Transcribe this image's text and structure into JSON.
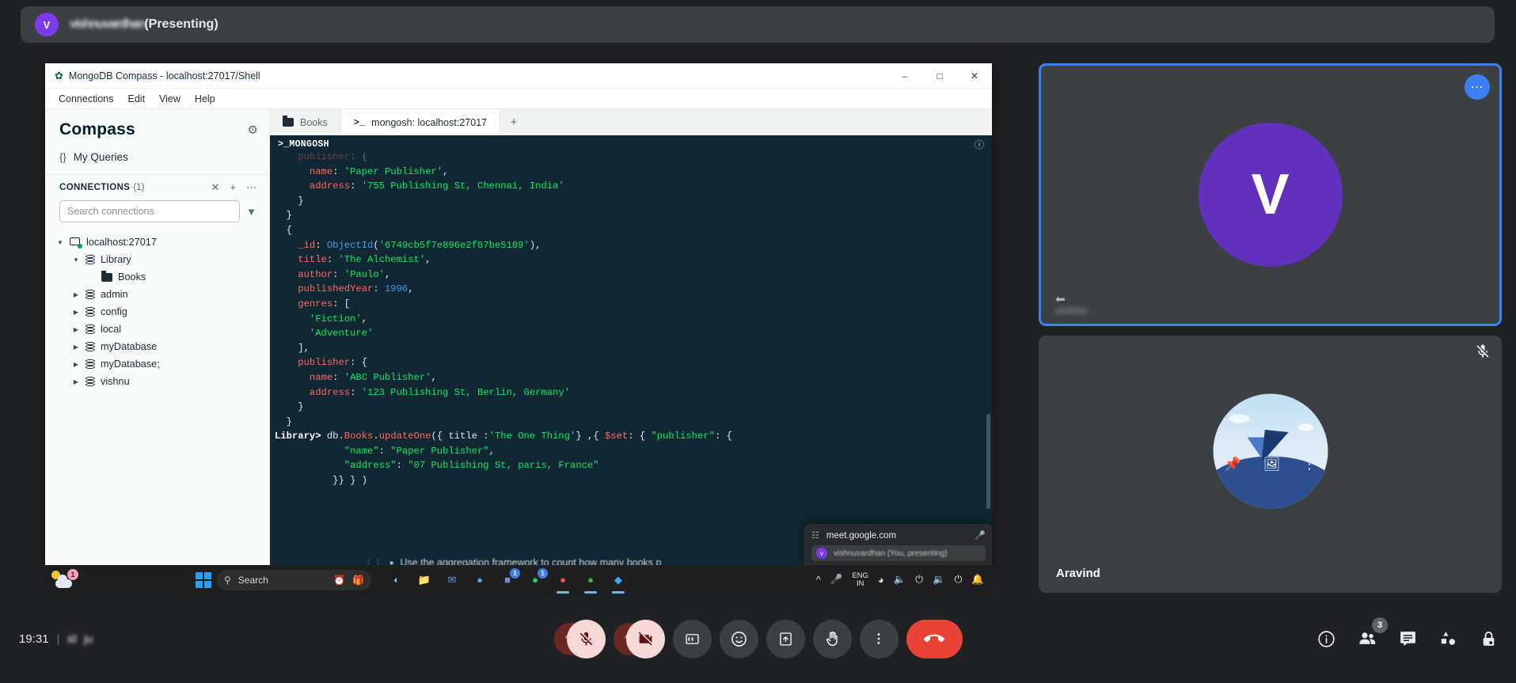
{
  "meet": {
    "topbar": {
      "avatar_initial": "V",
      "obscured_title": "vishnuvardhan",
      "title_suffix": "(Presenting)"
    },
    "tiles": [
      {
        "name": "presenter-tile",
        "avatar_initial": "V",
        "more_icon": "more-horizontal-icon",
        "blurred_name": "vishnu"
      },
      {
        "name": "participant-tile",
        "label": "Aravind",
        "mic_icon": "mic-off-icon",
        "hover_icons": [
          "pin-icon",
          "picture-in-picture-icon",
          "more-vertical-icon"
        ]
      }
    ],
    "bottom": {
      "time": "19:31",
      "separator": "|",
      "meeting_code_left": "id",
      "meeting_code_right": "ju",
      "controls": [
        {
          "name": "mic-options-chevron",
          "icon": "chevron-up-icon",
          "label": ""
        },
        {
          "name": "mic-toggle",
          "icon": "mic-off-icon",
          "label": ""
        },
        {
          "name": "camera-options-chevron",
          "icon": "chevron-up-icon",
          "label": ""
        },
        {
          "name": "camera-toggle",
          "icon": "video-off-icon",
          "label": ""
        },
        {
          "name": "captions-toggle",
          "icon": "closed-captions-icon",
          "label": ""
        },
        {
          "name": "reactions-button",
          "icon": "emoji-icon",
          "label": ""
        },
        {
          "name": "present-now-button",
          "icon": "present-screen-icon",
          "label": ""
        },
        {
          "name": "raise-hand-button",
          "icon": "raise-hand-icon",
          "label": ""
        },
        {
          "name": "more-options-button",
          "icon": "more-vertical-icon",
          "label": ""
        },
        {
          "name": "leave-call-button",
          "icon": "end-call-icon",
          "label": ""
        }
      ],
      "right_controls": [
        {
          "name": "meeting-details-button",
          "icon": "info-icon",
          "badge": ""
        },
        {
          "name": "participants-button",
          "icon": "people-icon",
          "badge": "3"
        },
        {
          "name": "chat-button",
          "icon": "chat-icon",
          "badge": ""
        },
        {
          "name": "activities-button",
          "icon": "activities-icon",
          "badge": ""
        },
        {
          "name": "host-controls-button",
          "icon": "lock-icon",
          "badge": ""
        }
      ]
    }
  },
  "compass": {
    "window_title": "MongoDB Compass - localhost:27017/Shell",
    "window_buttons": {
      "minimize": "–",
      "maximize": "□",
      "close": "✕"
    },
    "menus": [
      "Connections",
      "Edit",
      "View",
      "Help"
    ],
    "brand": "Compass",
    "gear_icon": "gear-icon",
    "my_queries": "My Queries",
    "connections_header": {
      "label": "CONNECTIONS",
      "count": "(1)",
      "actions": [
        "collapse-icon",
        "add-icon",
        "more-icon"
      ]
    },
    "search_placeholder": "Search connections",
    "filter_icon": "filter-icon",
    "tree": [
      {
        "label": "localhost:27017",
        "type": "host",
        "depth": 0,
        "caret": "open"
      },
      {
        "label": "Library",
        "type": "db",
        "depth": 1,
        "caret": "open"
      },
      {
        "label": "Books",
        "type": "collection",
        "depth": 2,
        "caret": "none"
      },
      {
        "label": "admin",
        "type": "db",
        "depth": 1,
        "caret": "closed"
      },
      {
        "label": "config",
        "type": "db",
        "depth": 1,
        "caret": "closed"
      },
      {
        "label": "local",
        "type": "db",
        "depth": 1,
        "caret": "closed"
      },
      {
        "label": "myDatabase",
        "type": "db",
        "depth": 1,
        "caret": "closed"
      },
      {
        "label": "myDatabase;",
        "type": "db",
        "depth": 1,
        "caret": "closed"
      },
      {
        "label": "vishnu",
        "type": "db",
        "depth": 1,
        "caret": "closed"
      }
    ],
    "tabs": [
      {
        "label": "Books",
        "icon": "folder-icon",
        "active": false
      },
      {
        "label": "mongosh: localhost:27017",
        "icon": "shell-icon",
        "active": true
      }
    ],
    "tab_add": "+",
    "shell": {
      "header_label": ">_MONGOSH",
      "info_icon": "info-icon",
      "lines": [
        {
          "indent": 4,
          "segments": [
            {
              "t": "publisher",
              "c": "key"
            },
            {
              "t": ": {",
              "c": "plain"
            }
          ],
          "faded": true
        },
        {
          "indent": 6,
          "segments": [
            {
              "t": "name",
              "c": "key"
            },
            {
              "t": ": ",
              "c": "plain"
            },
            {
              "t": "'Paper Publisher'",
              "c": "str"
            },
            {
              "t": ",",
              "c": "plain"
            }
          ]
        },
        {
          "indent": 6,
          "segments": [
            {
              "t": "address",
              "c": "key"
            },
            {
              "t": ": ",
              "c": "plain"
            },
            {
              "t": "'755 Publishing St, Chennai, India'",
              "c": "str"
            }
          ]
        },
        {
          "indent": 4,
          "segments": [
            {
              "t": "}",
              "c": "plain"
            }
          ]
        },
        {
          "indent": 2,
          "segments": [
            {
              "t": "}",
              "c": "plain"
            }
          ]
        },
        {
          "indent": 2,
          "segments": [
            {
              "t": "{",
              "c": "plain"
            }
          ]
        },
        {
          "indent": 4,
          "segments": [
            {
              "t": "_id",
              "c": "key"
            },
            {
              "t": ": ",
              "c": "plain"
            },
            {
              "t": "ObjectId",
              "c": "oid"
            },
            {
              "t": "(",
              "c": "plain"
            },
            {
              "t": "'6749cb5f7e896e2f87be5109'",
              "c": "str"
            },
            {
              "t": "),",
              "c": "plain"
            }
          ]
        },
        {
          "indent": 4,
          "segments": [
            {
              "t": "title",
              "c": "key"
            },
            {
              "t": ": ",
              "c": "plain"
            },
            {
              "t": "'The Alchemist'",
              "c": "str"
            },
            {
              "t": ",",
              "c": "plain"
            }
          ]
        },
        {
          "indent": 4,
          "segments": [
            {
              "t": "author",
              "c": "key"
            },
            {
              "t": ": ",
              "c": "plain"
            },
            {
              "t": "'Paulo'",
              "c": "str"
            },
            {
              "t": ",",
              "c": "plain"
            }
          ]
        },
        {
          "indent": 4,
          "segments": [
            {
              "t": "publishedYear",
              "c": "key"
            },
            {
              "t": ": ",
              "c": "plain"
            },
            {
              "t": "1996",
              "c": "num"
            },
            {
              "t": ",",
              "c": "plain"
            }
          ]
        },
        {
          "indent": 4,
          "segments": [
            {
              "t": "genres",
              "c": "key"
            },
            {
              "t": ": [",
              "c": "plain"
            }
          ]
        },
        {
          "indent": 6,
          "segments": [
            {
              "t": "'Fiction'",
              "c": "str"
            },
            {
              "t": ",",
              "c": "plain"
            }
          ]
        },
        {
          "indent": 6,
          "segments": [
            {
              "t": "'Adventure'",
              "c": "str"
            }
          ]
        },
        {
          "indent": 4,
          "segments": [
            {
              "t": "],",
              "c": "plain"
            }
          ]
        },
        {
          "indent": 4,
          "segments": [
            {
              "t": "publisher",
              "c": "key"
            },
            {
              "t": ": {",
              "c": "plain"
            }
          ]
        },
        {
          "indent": 6,
          "segments": [
            {
              "t": "name",
              "c": "key"
            },
            {
              "t": ": ",
              "c": "plain"
            },
            {
              "t": "'ABC Publisher'",
              "c": "str"
            },
            {
              "t": ",",
              "c": "plain"
            }
          ]
        },
        {
          "indent": 6,
          "segments": [
            {
              "t": "address",
              "c": "key"
            },
            {
              "t": ": ",
              "c": "plain"
            },
            {
              "t": "'123 Publishing St, Berlin, Germany'",
              "c": "str"
            }
          ]
        },
        {
          "indent": 4,
          "segments": [
            {
              "t": "}",
              "c": "plain"
            }
          ]
        },
        {
          "indent": 2,
          "segments": [
            {
              "t": "}",
              "c": "plain"
            }
          ]
        },
        {
          "indent": 0,
          "segments": [
            {
              "t": "Library> ",
              "c": "prompt"
            },
            {
              "t": "db.",
              "c": "plain"
            },
            {
              "t": "Books",
              "c": "coll"
            },
            {
              "t": ".",
              "c": "plain"
            },
            {
              "t": "updateOne",
              "c": "fn"
            },
            {
              "t": "({ title :",
              "c": "plain"
            },
            {
              "t": "'The One Thing'",
              "c": "str"
            },
            {
              "t": "} ,{ ",
              "c": "plain"
            },
            {
              "t": "$set",
              "c": "dollar"
            },
            {
              "t": ": { ",
              "c": "plain"
            },
            {
              "t": "\"publisher\"",
              "c": "str"
            },
            {
              "t": ": {",
              "c": "plain"
            }
          ]
        },
        {
          "indent": 12,
          "segments": [
            {
              "t": "\"name\"",
              "c": "str"
            },
            {
              "t": ": ",
              "c": "plain"
            },
            {
              "t": "\"Paper Publisher\"",
              "c": "str"
            },
            {
              "t": ",",
              "c": "plain"
            }
          ]
        },
        {
          "indent": 12,
          "segments": [
            {
              "t": "\"address\"",
              "c": "str"
            },
            {
              "t": ": ",
              "c": "plain"
            },
            {
              "t": "\"07 Publishing St, paris, France\"",
              "c": "str"
            }
          ]
        },
        {
          "indent": 10,
          "segments": [
            {
              "t": "}} } )",
              "c": "plain"
            }
          ]
        }
      ]
    },
    "chrome_popup": {
      "url": "meet.google.com",
      "key_icon": "password-key-icon",
      "mic_icon": "mic-icon",
      "suggestion_initial": "v",
      "suggestion_text": "vishnuvardhan (You, presenting)"
    }
  },
  "hint_strip": {
    "dots_icon": "drag-handle-icon",
    "bullet": "●",
    "text": "Use the aggregation framework to count how many books p"
  },
  "taskbar": {
    "weather_badge": "1",
    "windows_icon": "windows-logo-icon",
    "search_placeholder": "Search",
    "search_icons": [
      "alarm-icon",
      "gift-icon"
    ],
    "apps": [
      {
        "name": "edge-copilot-icon",
        "glyph": "◐",
        "badge": "",
        "active": false
      },
      {
        "name": "file-explorer-icon",
        "glyph": "📁",
        "badge": "",
        "active": false
      },
      {
        "name": "mail-icon",
        "glyph": "✉",
        "badge": "",
        "active": false
      },
      {
        "name": "edge-browser-icon",
        "glyph": "●",
        "badge": "",
        "active": false
      },
      {
        "name": "teams-icon",
        "glyph": "■",
        "badge": "1",
        "active": false
      },
      {
        "name": "whatsapp-icon",
        "glyph": "●",
        "badge": "1",
        "active": false
      },
      {
        "name": "chrome-icon",
        "glyph": "●",
        "badge": "",
        "active": true
      },
      {
        "name": "mongodb-compass-icon",
        "glyph": "●",
        "badge": "",
        "active": true
      },
      {
        "name": "vscode-icon",
        "glyph": "◆",
        "badge": "",
        "active": true
      }
    ],
    "tray": {
      "chevron": "chevron-up-icon",
      "mic": "mic-icon",
      "language_line1": "ENG",
      "language_line2": "IN",
      "wifi": "wifi-icon",
      "volume1": "volume-icon",
      "battery1": "battery-icon",
      "volume2": "volume-icon",
      "battery2": "battery-icon",
      "notifications": "notification-bell-icon"
    }
  },
  "colors": {
    "meet_bg": "#202124",
    "tile_bg": "#3c4043",
    "accent_blue": "#3b7ff5",
    "avatar_purple": "#6131bd",
    "danger_red": "#ea4335",
    "shell_bg": "#112733",
    "shell_key": "#ff6960",
    "shell_string": "#00ed64",
    "shell_number": "#3d9cf0",
    "compass_green": "#00684a"
  }
}
